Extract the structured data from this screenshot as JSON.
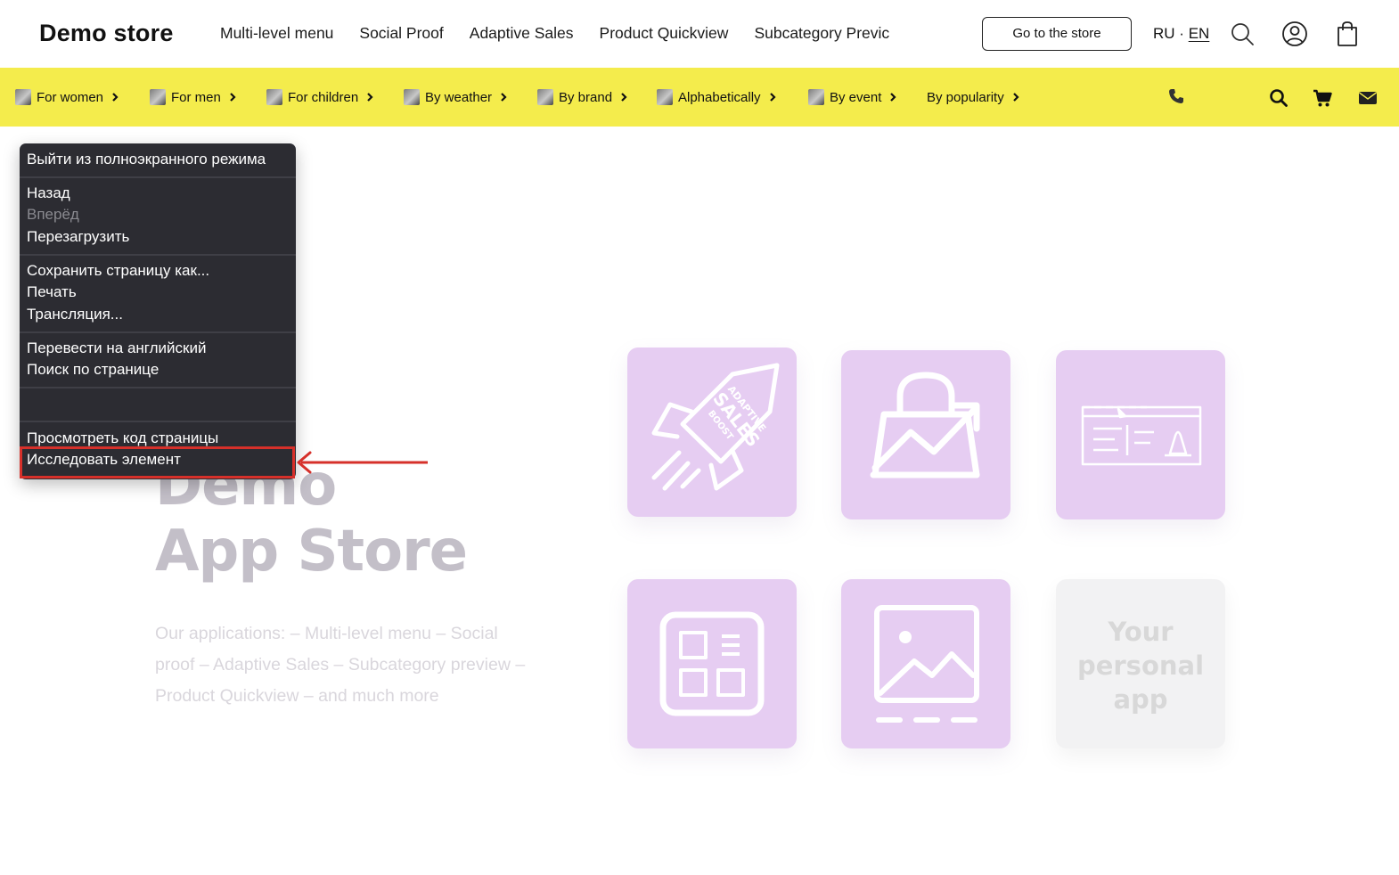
{
  "header": {
    "logo": "Demo store",
    "nav": [
      "Multi-level menu",
      "Social Proof",
      "Adaptive Sales",
      "Product Quickview",
      "Subcategory Previc"
    ],
    "store_button": "Go to the store",
    "lang_ru": "RU",
    "lang_sep": "·",
    "lang_en": "EN",
    "icons": [
      "search-icon",
      "user-icon",
      "bag-icon"
    ]
  },
  "categories": [
    {
      "label": "For women"
    },
    {
      "label": "For men"
    },
    {
      "label": "For children"
    },
    {
      "label": "By weather"
    },
    {
      "label": "By brand"
    },
    {
      "label": "Alphabetically"
    },
    {
      "label": "By event"
    },
    {
      "label": "By popularity"
    }
  ],
  "catbar_icons": [
    "phone-icon",
    "search-icon",
    "cart-icon",
    "mail-icon"
  ],
  "hero": {
    "title_line1": "Demo",
    "title_line2": "App Store",
    "description": "Our applications: – Multi-level menu – Social proof – Adaptive Sales – Subcategory preview – Product Quickview – and much more"
  },
  "tiles": {
    "rocket_text": [
      "ADAPTIVE",
      "SALES",
      "BOOST"
    ],
    "personal_app": [
      "Your",
      "personal",
      "app"
    ]
  },
  "context_menu": {
    "exit_fullscreen": "Выйти из полноэкранного режима",
    "back": "Назад",
    "forward": "Вперёд",
    "reload": "Перезагрузить",
    "save_as": "Сохранить страницу как...",
    "print": "Печать",
    "cast": "Трансляция...",
    "translate": "Перевести на английский",
    "find": "Поиск по странице",
    "view_source": "Просмотреть код страницы",
    "inspect": "Исследовать элемент"
  },
  "colors": {
    "accent_bar": "#f4ec4c",
    "tile": "#e6cdf2",
    "menu_bg": "#2c2c32",
    "highlight": "#d6302a"
  }
}
